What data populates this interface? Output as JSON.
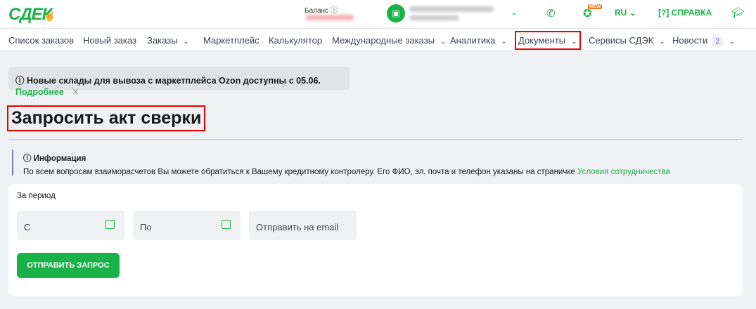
{
  "header": {
    "logo": "СДЕК",
    "balance_label": "Баланс",
    "lang": "RU",
    "help_label": "СПРАВКА",
    "new_badge": "NEW"
  },
  "nav": {
    "items": [
      {
        "label": "Список заказов"
      },
      {
        "label": "Новый заказ"
      },
      {
        "label": "Заказы"
      },
      {
        "label": "Маркетплейс"
      },
      {
        "label": "Калькулятор"
      },
      {
        "label": "Международные заказы"
      },
      {
        "label": "Аналитика"
      },
      {
        "label": "Документы"
      },
      {
        "label": "Сервисы СДЭК"
      },
      {
        "label": "Новости"
      }
    ],
    "news_count": "2"
  },
  "notice": {
    "text": "Новые склады для вывоза с маркетплейса Ozon доступны с 05.06.",
    "link": "Подробнее"
  },
  "page": {
    "title": "Запросить акт сверки"
  },
  "info": {
    "title": "Информация",
    "text": "По всем вопросам взаиморасчетов Вы можете обратиться к Вашему кредитному контролеру. Его ФИО, эл. почта и телефон указаны на страничке",
    "link": "Условия сотрудничества"
  },
  "form": {
    "period_label": "За период",
    "from_placeholder": "С",
    "to_placeholder": "По",
    "email_placeholder": "Отправить на email",
    "submit": "ОТПРАВИТЬ ЗАПРОС"
  }
}
